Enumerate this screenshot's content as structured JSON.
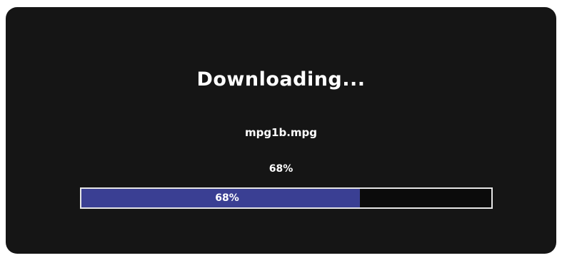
{
  "dialog": {
    "title": "Downloading...",
    "filename": "mpg1b.mpg",
    "percent_text": "68%"
  },
  "progress": {
    "value": 0.68,
    "label": "68%"
  },
  "colors": {
    "background": "#151515",
    "fill": "#3a3f93",
    "track_border": "#e6e6e6",
    "text": "#ffffff"
  }
}
